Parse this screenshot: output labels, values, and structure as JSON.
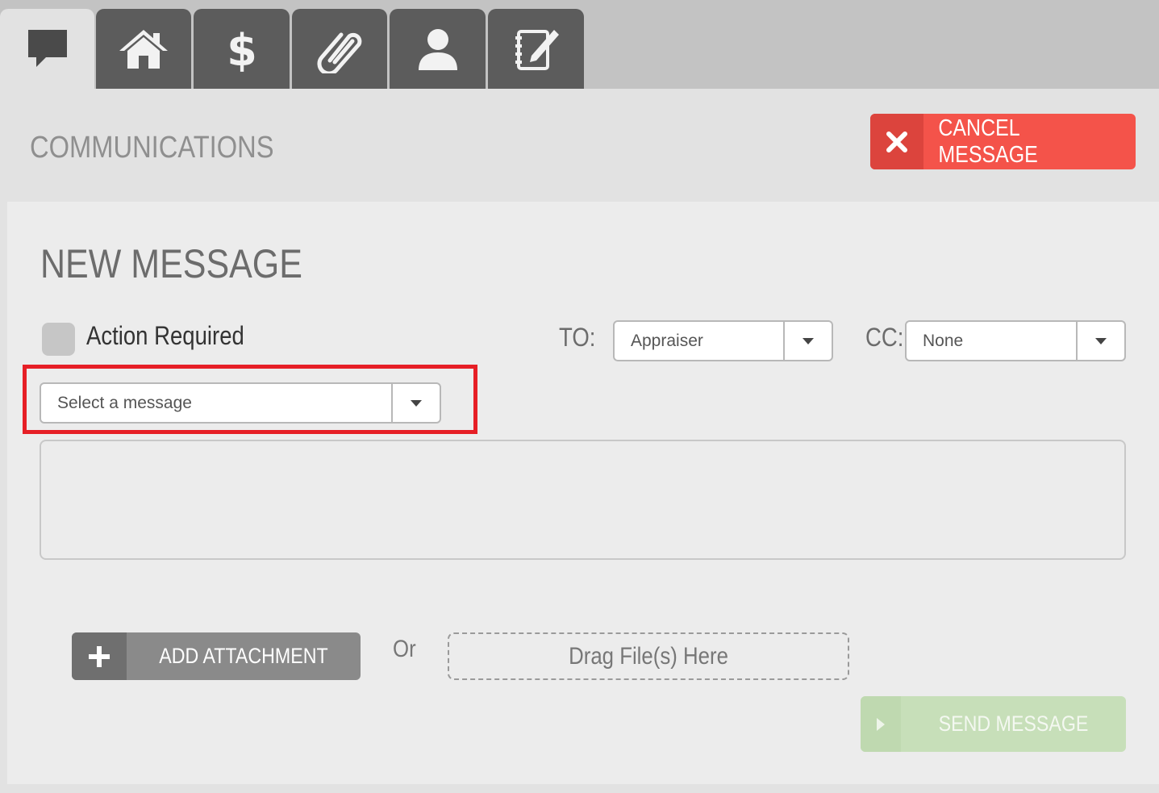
{
  "tabs": [
    {
      "icon": "chat-bubble-icon",
      "active": true
    },
    {
      "icon": "home-icon",
      "active": false
    },
    {
      "icon": "dollar-icon",
      "active": false
    },
    {
      "icon": "paperclip-icon",
      "active": false
    },
    {
      "icon": "user-icon",
      "active": false
    },
    {
      "icon": "notepad-pen-icon",
      "active": false
    }
  ],
  "header": {
    "title": "COMMUNICATIONS",
    "cancel_label": "CANCEL MESSAGE",
    "cancel_icon": "close-icon"
  },
  "form": {
    "title": "NEW MESSAGE",
    "action_required_label": "Action Required",
    "action_required_checked": false,
    "to_label": "TO:",
    "to_value": "Appraiser",
    "cc_label": "CC:",
    "cc_value": "None",
    "message_select_value": "Select a message",
    "body_text": "",
    "add_attachment_label": "ADD ATTACHMENT",
    "or_text": "Or",
    "dropzone_label": "Drag File(s) Here",
    "send_label": "SEND MESSAGE"
  },
  "colors": {
    "cancel": "#f4534a",
    "send_disabled": "#c7dfb9",
    "highlight": "#e61f26",
    "tab_dark": "#5c5c5c"
  }
}
